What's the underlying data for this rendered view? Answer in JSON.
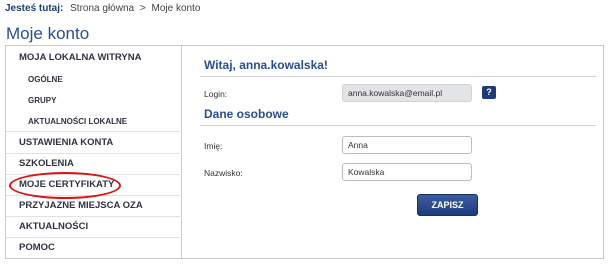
{
  "breadcrumb": {
    "lead": "Jesteś tutaj:",
    "home": "Strona główna",
    "separator": ">",
    "current": "Moje konto"
  },
  "page": {
    "title": "Moje konto"
  },
  "sidebar": {
    "items": [
      {
        "label": "MOJA LOKALNA WITRYNA"
      },
      {
        "label": "OGÓLNE"
      },
      {
        "label": "GRUPY"
      },
      {
        "label": "AKTUALNOŚCI LOKALNE"
      },
      {
        "label": "USTAWIENIA KONTA"
      },
      {
        "label": "SZKOLENIA"
      },
      {
        "label": "MOJE CERTYFIKATY"
      },
      {
        "label": "PRZYJAZNE MIEJSCA OZA"
      },
      {
        "label": "AKTUALNOŚCI"
      },
      {
        "label": "POMOC"
      }
    ],
    "highlight_color": "#e01010"
  },
  "main": {
    "welcome": "Witaj, anna.kowalska!",
    "login_label": "Login:",
    "login_value": "anna.kowalska@email.pl",
    "help_label": "?",
    "section_title": "Dane osobowe",
    "first_name_label": "Imię:",
    "first_name_value": "Anna",
    "last_name_label": "Nazwisko:",
    "last_name_value": "Kowalska",
    "save_label": "ZAPISZ"
  },
  "colors": {
    "accent": "#2b4f8e",
    "button": "#1f3c7a"
  }
}
